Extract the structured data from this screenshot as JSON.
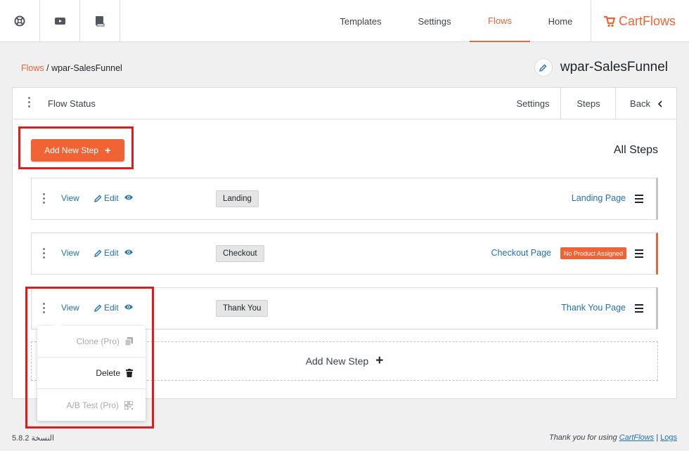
{
  "topbar": {
    "icon_buttons": [
      "support-icon",
      "youtube-icon",
      "docs-book-icon"
    ],
    "nav": [
      {
        "label": "Templates",
        "active": false
      },
      {
        "label": "Settings",
        "active": false
      },
      {
        "label": "Flows",
        "active": true
      },
      {
        "label": "Home",
        "active": false
      }
    ],
    "logo_text": "CartFlows"
  },
  "header": {
    "breadcrumb_root": "Flows",
    "breadcrumb_sep": " / ",
    "breadcrumb_current": "wpar-SalesFunnel",
    "flow_title": "wpar-SalesFunnel"
  },
  "panel": {
    "flow_status_label": "Flow Status",
    "tabs": [
      {
        "label": "Settings",
        "active": false
      },
      {
        "label": "Steps",
        "active": true
      },
      {
        "label": "Back",
        "active": false
      }
    ],
    "add_new_step_label": "Add New Step",
    "all_steps_title": "All Steps",
    "steps": [
      {
        "view": "View",
        "edit": "Edit",
        "tag": "Landing",
        "page_link": "Landing Page",
        "badge": ""
      },
      {
        "view": "View",
        "edit": "Edit",
        "tag": "Checkout",
        "page_link": "Checkout Page",
        "badge": "No Product Assigned"
      },
      {
        "view": "View",
        "edit": "Edit",
        "tag": "Thank You",
        "page_link": "Thank You Page",
        "badge": ""
      }
    ],
    "add_new_step_dashed_label": "Add New Step",
    "dropdown": [
      {
        "label": "Clone (Pro)",
        "icon": "copy-icon",
        "disabled": true
      },
      {
        "label": "Delete",
        "icon": "trash-icon",
        "disabled": false
      },
      {
        "label": "A/B Test (Pro)",
        "icon": "qr-icon",
        "disabled": true
      }
    ]
  },
  "footer": {
    "version": "5.8.2 النسخة",
    "thanks_text": "Thank you for using ",
    "thanks_link": "CartFlows",
    "separator": " | ",
    "logs": "Logs"
  },
  "colors": {
    "accent": "#f06335",
    "link": "#2271b1",
    "highlight": "#e01d1d"
  }
}
